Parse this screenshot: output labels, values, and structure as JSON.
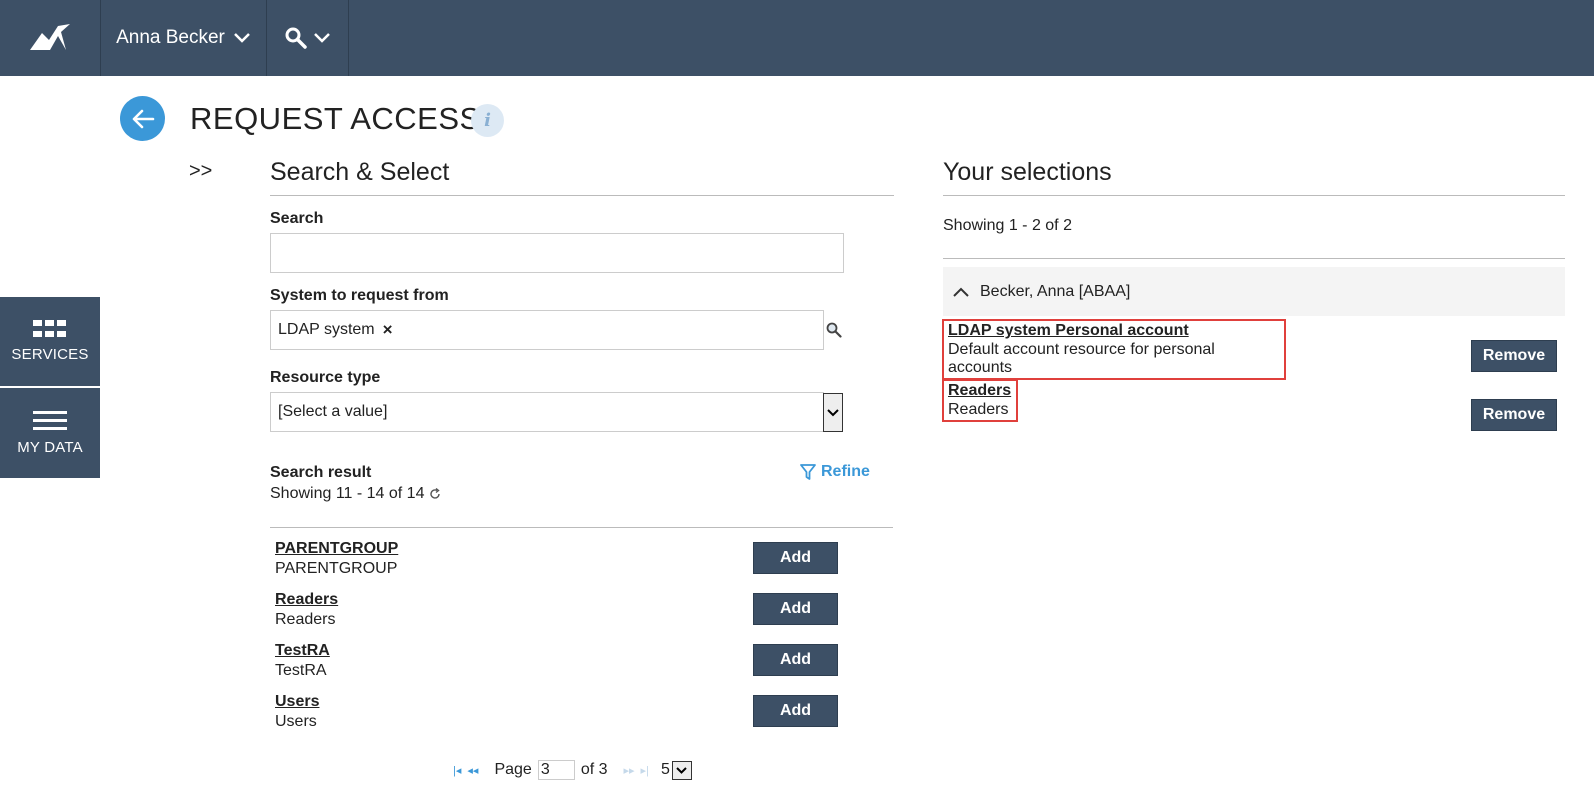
{
  "header": {
    "user_name": "Anna Becker"
  },
  "sidebar": {
    "services_label": "SERVICES",
    "mydata_label": "MY DATA"
  },
  "page": {
    "title": "REQUEST ACCESS",
    "expand_label": ">>",
    "info_icon": "i"
  },
  "search_panel": {
    "heading": "Search & Select",
    "search_label": "Search",
    "search_value": "",
    "system_label": "System to request from",
    "system_value": "LDAP system",
    "system_clear": "×",
    "resource_type_label": "Resource type",
    "resource_type_value": "[Select a value]",
    "result_label": "Search result",
    "result_count": "Showing 11 - 14 of 14",
    "refine_label": "Refine",
    "results": [
      {
        "name": "PARENTGROUP",
        "sub": "PARENTGROUP",
        "action": "Add"
      },
      {
        "name": "Readers",
        "sub": "Readers",
        "action": "Add"
      },
      {
        "name": "TestRA",
        "sub": "TestRA",
        "action": "Add"
      },
      {
        "name": "Users",
        "sub": "Users",
        "action": "Add"
      }
    ],
    "pager": {
      "page_label": "Page",
      "page_value": "3",
      "of_label": "of 3",
      "page_size": "5"
    }
  },
  "selections_panel": {
    "heading": "Your selections",
    "count": "Showing 1 - 2 of 2",
    "group_name": "Becker, Anna [ABAA]",
    "items": [
      {
        "name": "LDAP system Personal account",
        "sub": "Default account resource for personal accounts",
        "action": "Remove"
      },
      {
        "name": "Readers",
        "sub": "Readers",
        "action": "Remove"
      }
    ]
  },
  "colors": {
    "nav_bg": "#3d5066",
    "accent": "#3b98d8",
    "highlight_border": "#e0403c"
  }
}
